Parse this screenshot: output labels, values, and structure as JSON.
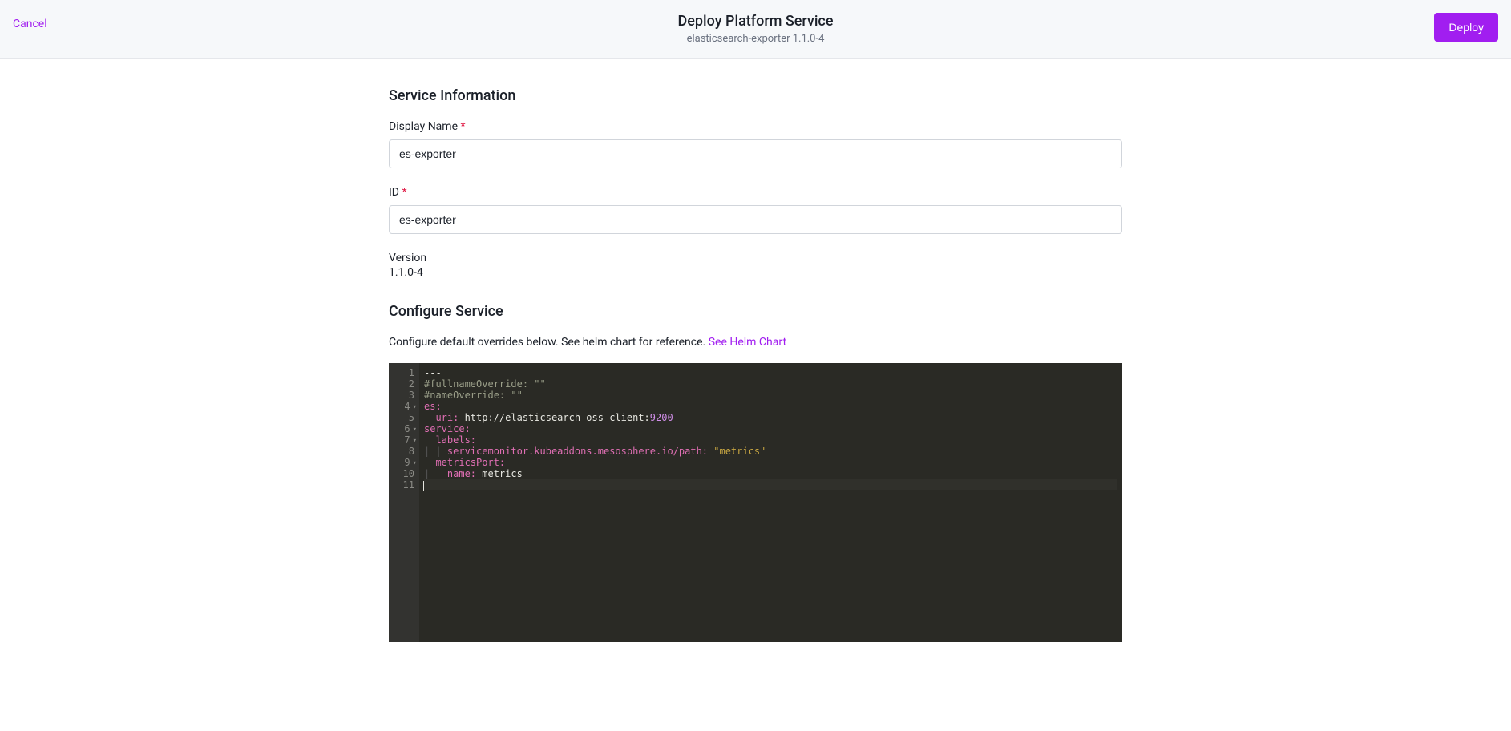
{
  "header": {
    "cancel_label": "Cancel",
    "title": "Deploy Platform Service",
    "subtitle": "elasticsearch-exporter 1.1.0-4",
    "deploy_label": "Deploy"
  },
  "service_info": {
    "section_title": "Service Information",
    "display_name_label": "Display Name",
    "display_name_value": "es-exporter",
    "id_label": "ID",
    "id_value": "es-exporter",
    "version_label": "Version",
    "version_value": "1.1.0-4"
  },
  "configure": {
    "section_title": "Configure Service",
    "description_prefix": "Configure default overrides below. See helm chart for reference. ",
    "helm_link_label": "See Helm Chart"
  },
  "editor": {
    "lines": [
      {
        "num": "1",
        "fold": false,
        "tokens": [
          {
            "cls": "c-plain",
            "t": "---"
          }
        ]
      },
      {
        "num": "2",
        "fold": false,
        "tokens": [
          {
            "cls": "c-comment",
            "t": "#fullnameOverride: \"\""
          }
        ]
      },
      {
        "num": "3",
        "fold": false,
        "tokens": [
          {
            "cls": "c-comment",
            "t": "#nameOverride: \"\""
          }
        ]
      },
      {
        "num": "4",
        "fold": true,
        "tokens": [
          {
            "cls": "c-key",
            "t": "es:"
          }
        ]
      },
      {
        "num": "5",
        "fold": false,
        "tokens": [
          {
            "cls": "c-indent",
            "t": "  "
          },
          {
            "cls": "c-key",
            "t": "uri:"
          },
          {
            "cls": "c-plain",
            "t": " http://elasticsearch-oss-client:"
          },
          {
            "cls": "c-num",
            "t": "9200"
          }
        ]
      },
      {
        "num": "6",
        "fold": true,
        "tokens": [
          {
            "cls": "c-key",
            "t": "service:"
          }
        ]
      },
      {
        "num": "7",
        "fold": true,
        "tokens": [
          {
            "cls": "c-indent",
            "t": "  "
          },
          {
            "cls": "c-key",
            "t": "labels:"
          }
        ]
      },
      {
        "num": "8",
        "fold": false,
        "tokens": [
          {
            "cls": "c-indent",
            "t": "| | "
          },
          {
            "cls": "c-key",
            "t": "servicemonitor.kubeaddons.mesosphere.io/path:"
          },
          {
            "cls": "c-plain",
            "t": " "
          },
          {
            "cls": "c-str",
            "t": "\"metrics\""
          }
        ]
      },
      {
        "num": "9",
        "fold": true,
        "tokens": [
          {
            "cls": "c-indent",
            "t": "  "
          },
          {
            "cls": "c-key",
            "t": "metricsPort:"
          }
        ]
      },
      {
        "num": "10",
        "fold": false,
        "tokens": [
          {
            "cls": "c-indent",
            "t": "|   "
          },
          {
            "cls": "c-key",
            "t": "name:"
          },
          {
            "cls": "c-plain",
            "t": " metrics"
          }
        ]
      },
      {
        "num": "11",
        "fold": false,
        "tokens": []
      }
    ]
  }
}
